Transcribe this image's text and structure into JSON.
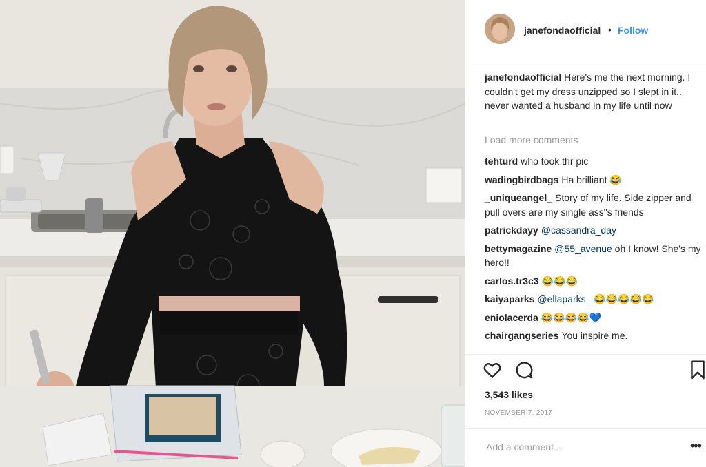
{
  "post": {
    "username": "janefondaofficial",
    "separator": "•",
    "follow_label": "Follow",
    "caption_user": "janefondaofficial",
    "caption_text": "Here's me the next morning. I couldn't get my dress unzipped so I slept in it.. never wanted a husband in my life until now",
    "load_more": "Load more comments",
    "likes": "3,543 likes",
    "date": "NOVEMBER 7, 2017",
    "add_comment_placeholder": "Add a comment...",
    "more_options": "•••"
  },
  "comments": [
    {
      "user": "tehturd",
      "mention": "",
      "text": "who took thr pic"
    },
    {
      "user": "wadingbirdbags",
      "mention": "",
      "text": "Ha brilliant 😂"
    },
    {
      "user": "_uniqueangel_",
      "mention": "",
      "text": "Story of my life. Side zipper and pull overs are my single ass\"s friends"
    },
    {
      "user": "patrickdayy",
      "mention": "@cassandra_day",
      "text": ""
    },
    {
      "user": "bettymagazine",
      "mention": "@55_avenue",
      "text": "oh I know! She's my hero!!"
    },
    {
      "user": "carlos.tr3c3",
      "mention": "",
      "text": "😂😂😂"
    },
    {
      "user": "kaiyaparks",
      "mention": "@ellaparks_",
      "text": "😂😂😂😂😂"
    },
    {
      "user": "eniolacerda",
      "mention": "",
      "text": "😂😂😂😂💙"
    },
    {
      "user": "chairgangseries",
      "mention": "",
      "text": "You inspire me."
    }
  ],
  "icons": {
    "like": "heart-icon",
    "comment": "comment-bubble-icon",
    "save": "bookmark-icon"
  },
  "colors": {
    "link_blue": "#3897f0",
    "mention_blue": "#003569",
    "muted_gray": "#999999",
    "text": "#262626"
  }
}
